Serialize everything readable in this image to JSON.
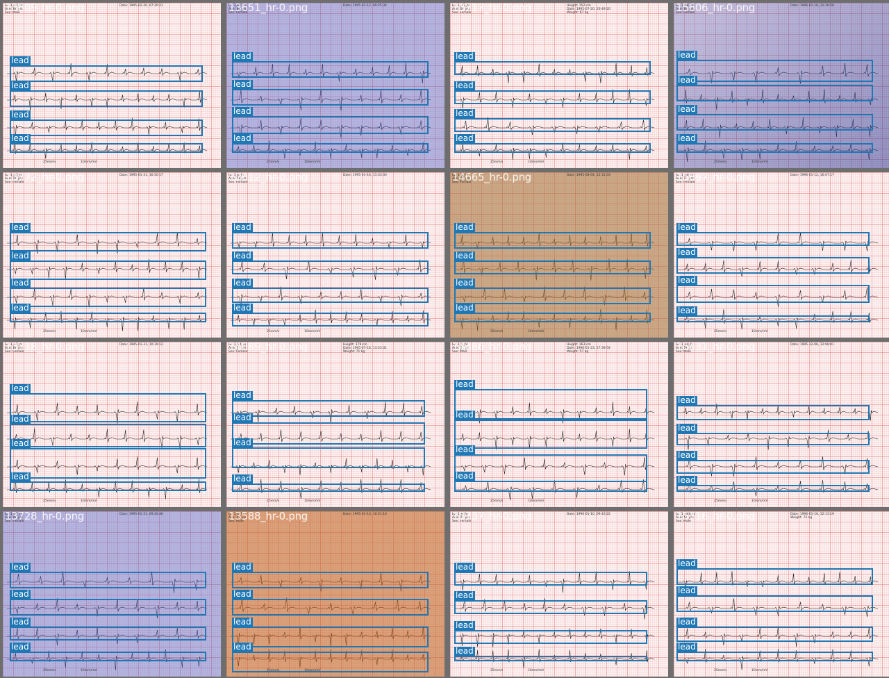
{
  "tiles": [
    {
      "filename": "13609_hr-0.png",
      "header": [
        "ID: 1_78_hr",
        "Age: 66 yrs",
        "Sex: Male"
      ],
      "header_right": [
        "Date: 1995-02-20, 07:20:21"
      ],
      "tint": "none",
      "leads": [
        "I",
        "aVR",
        "V1",
        "V4",
        "II",
        "aVL",
        "V2",
        "V5",
        "III",
        "aVF",
        "V3",
        "V6",
        "II"
      ]
    },
    {
      "filename": "13651_hr-0.png",
      "header": [
        "ID: 1_80_hr",
        "Age: 60 yrs",
        "Sex: Female"
      ],
      "header_right": [
        "Date: 1995-01-12, 09:25:34"
      ],
      "tint": "blue",
      "leads": []
    },
    {
      "filename": "13717_hr-0.png",
      "header": [
        "ID: 1_75_hr",
        "Age: 66 yrs",
        "Sex: Female"
      ],
      "header_right": [
        "Height: 152 cm",
        "Date: 1995-07-20, 20:49:20",
        "Weight: 67 kg"
      ],
      "tint": "none",
      "leads": []
    },
    {
      "filename": "15606_hr-0.png",
      "header": [
        "ID: 1_78_hr",
        "Age: 48 yrs",
        "Sex: Female"
      ],
      "header_right": [
        "Date: 1996-01-16, 12:36:56"
      ],
      "tint": "blue2",
      "leads": []
    },
    {
      "filename": "13772_hr-0.png",
      "header": [
        "ID: 1_75_hr",
        "Age: 78 yrs",
        "Sex: Female"
      ],
      "header_right": [
        "Date: 1995-01-31, 16:50:17"
      ],
      "tint": "none",
      "leads": []
    },
    {
      "filename": "12612_hr-0.png",
      "header": [
        "ID: 1_6_hr",
        "Age: 66 yrs",
        "Sex: Female"
      ],
      "header_right": [
        "Date: 1995-01-16, 11:33:33"
      ],
      "tint": "none",
      "leads": []
    },
    {
      "filename": "14665_hr-0.png",
      "header": [
        "ID: 1_6_hr",
        "Age: 66 yrs",
        "Sex: Female"
      ],
      "header_right": [
        "Date: 1995-08-04, 12:31:03"
      ],
      "tint": "tan",
      "leads": []
    },
    {
      "filename": "15697_hr-0.png",
      "header": [
        "ID: 1_50_hr",
        "Age: 77 yrs",
        "Sex: Female"
      ],
      "header_right": [
        "Date: 1996-01-12, 16:07:17"
      ],
      "tint": "none",
      "leads": []
    },
    {
      "filename": "13718_hr-0.png",
      "header": [
        "ID: 1_72_hr",
        "Age: 68 yrs",
        "Sex: Female"
      ],
      "header_right": [
        "Date: 1995-01-31, 10:39:12"
      ],
      "tint": "none",
      "leads": []
    },
    {
      "filename": "14089_hr-0.png",
      "header": [
        "ID: 1_74_hr",
        "Age: 68 yrs",
        "Sex: Female"
      ],
      "header_right": [
        "Height: 179 cm",
        "Date: 1995-07-16, 13:53:31",
        "Weight: 71 kg"
      ],
      "tint": "none",
      "leads": []
    },
    {
      "filename": "14486_hr-0.png",
      "header": [
        "ID: 1_6_hr",
        "Age: 61 yrs",
        "Sex: Male"
      ],
      "header_right": [
        "Height: 163 cm",
        "Date: 1996-01-23, 17:39:54",
        "Weight: 57 kg"
      ],
      "tint": "none",
      "leads": []
    },
    {
      "filename": "15431_hr-0.png",
      "header": [
        "ID: 1_40_hr",
        "Age: 78 yrs",
        "Sex: Male"
      ],
      "header_right": [
        "Date: 1995-12-06, 12:08:01"
      ],
      "tint": "none",
      "leads": []
    },
    {
      "filename": "13728_hr-0.png",
      "header": [
        "ID: 1_72_hr",
        "Age: 49 yrs",
        "Sex: Female"
      ],
      "header_right": [
        "Date: 1995-01-31, 09:20:46"
      ],
      "tint": "blue",
      "leads": []
    },
    {
      "filename": "13588_hr-0.png",
      "header": [
        "ID: 1_6_hr",
        "Age: 52 yrs",
        "Sex: Male"
      ],
      "header_right": [
        "Date: 1995-01-13, 10:51:10"
      ],
      "tint": "orange",
      "leads": []
    },
    {
      "filename": "15737_hr-0.png",
      "header": [
        "ID: 1_6_hr",
        "Age: 73 yrs",
        "Sex: Female"
      ],
      "header_right": [
        "Date: 1996-01-10, 09:43:22"
      ],
      "tint": "none",
      "leads": []
    },
    {
      "filename": "15716_hr-0.png",
      "header": [
        "ID: 1_340_hr",
        "Age: 54 yrs",
        "Sex: Male"
      ],
      "header_right": [
        "Date: 1996-01-10, 12:13:19",
        "Weight: 72 kg"
      ],
      "tint": "none",
      "leads": []
    }
  ],
  "detections": [
    [
      [
        14,
        94,
        278,
        24,
        "lead"
      ],
      [
        14,
        130,
        278,
        24,
        "lead"
      ],
      [
        14,
        172,
        278,
        24,
        "lead"
      ],
      [
        14,
        206,
        278,
        14,
        "lead"
      ]
    ],
    [
      [
        334,
        88,
        283,
        24,
        "lead"
      ],
      [
        334,
        128,
        283,
        24,
        "lead"
      ],
      [
        334,
        167,
        283,
        26,
        "lead"
      ],
      [
        334,
        206,
        283,
        14,
        "lead"
      ]
    ],
    [
      [
        654,
        88,
        283,
        20,
        "lead"
      ],
      [
        654,
        130,
        283,
        20,
        "lead"
      ],
      [
        654,
        170,
        283,
        20,
        "lead"
      ],
      [
        654,
        206,
        283,
        14,
        "lead"
      ]
    ],
    [
      [
        974,
        86,
        283,
        32,
        "lead"
      ],
      [
        974,
        122,
        283,
        24,
        "lead"
      ],
      [
        974,
        164,
        283,
        24,
        "lead"
      ],
      [
        974,
        206,
        283,
        14,
        "lead"
      ]
    ],
    [
      [
        14,
        334,
        283,
        28,
        "lead"
      ],
      [
        14,
        375,
        283,
        28,
        "lead"
      ],
      [
        14,
        414,
        283,
        28,
        "lead"
      ],
      [
        14,
        450,
        283,
        14,
        "lead"
      ]
    ],
    [
      [
        334,
        334,
        283,
        24,
        "lead"
      ],
      [
        334,
        375,
        283,
        20,
        "lead"
      ],
      [
        334,
        414,
        283,
        22,
        "lead"
      ],
      [
        334,
        450,
        283,
        20,
        "lead"
      ]
    ],
    [
      [
        654,
        334,
        283,
        24,
        "lead"
      ],
      [
        654,
        375,
        283,
        20,
        "lead"
      ],
      [
        654,
        414,
        283,
        24,
        "lead"
      ],
      [
        654,
        450,
        283,
        14,
        "lead"
      ]
    ],
    [
      [
        974,
        334,
        278,
        20,
        "lead"
      ],
      [
        974,
        370,
        278,
        24,
        "lead"
      ],
      [
        974,
        410,
        278,
        26,
        "lead"
      ],
      [
        974,
        454,
        278,
        10,
        "lead"
      ]
    ],
    [
      [
        14,
        566,
        283,
        42,
        "lead"
      ],
      [
        14,
        610,
        283,
        34,
        "lead"
      ],
      [
        14,
        645,
        283,
        44,
        "lead"
      ],
      [
        14,
        693,
        283,
        14,
        "lead"
      ]
    ],
    [
      [
        334,
        576,
        278,
        24,
        "lead"
      ],
      [
        334,
        608,
        278,
        32,
        "lead"
      ],
      [
        334,
        644,
        278,
        30,
        "lead"
      ],
      [
        334,
        696,
        278,
        12,
        "lead"
      ]
    ],
    [
      [
        654,
        560,
        278,
        44,
        "lead"
      ],
      [
        654,
        604,
        278,
        42,
        "lead"
      ],
      [
        654,
        654,
        278,
        40,
        "lead"
      ],
      [
        654,
        692,
        278,
        16,
        "lead"
      ]
    ],
    [
      [
        974,
        583,
        278,
        22,
        "lead"
      ],
      [
        974,
        623,
        278,
        18,
        "lead"
      ],
      [
        974,
        662,
        278,
        20,
        "lead"
      ],
      [
        974,
        698,
        278,
        10,
        "lead"
      ]
    ],
    [
      [
        14,
        823,
        283,
        24,
        "lead"
      ],
      [
        14,
        862,
        283,
        24,
        "lead"
      ],
      [
        14,
        902,
        283,
        20,
        "lead"
      ],
      [
        14,
        938,
        283,
        14,
        "lead"
      ]
    ],
    [
      [
        334,
        823,
        283,
        24,
        "lead"
      ],
      [
        334,
        862,
        283,
        24,
        "lead"
      ],
      [
        334,
        902,
        283,
        30,
        "lead"
      ],
      [
        334,
        938,
        283,
        30,
        "lead"
      ]
    ],
    [
      [
        654,
        823,
        278,
        20,
        "lead"
      ],
      [
        654,
        864,
        278,
        20,
        "lead"
      ],
      [
        654,
        907,
        278,
        20,
        "lead"
      ],
      [
        654,
        944,
        278,
        8,
        "lead"
      ]
    ],
    [
      [
        974,
        818,
        283,
        24,
        "lead"
      ],
      [
        974,
        857,
        283,
        24,
        "lead"
      ],
      [
        974,
        902,
        283,
        22,
        "lead"
      ],
      [
        974,
        938,
        283,
        14,
        "lead"
      ]
    ]
  ],
  "footer": {
    "speed": "25mm/s",
    "gain": "10mm/mV"
  },
  "colors": {
    "box": "#1f77b4",
    "label_bg": "#1f77b4",
    "trace": "#222222"
  }
}
